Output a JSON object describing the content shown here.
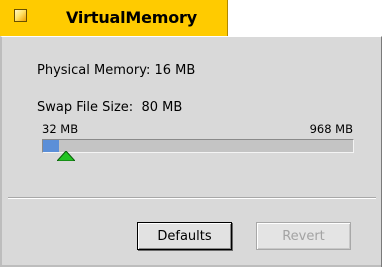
{
  "window": {
    "title": "VirtualMemory"
  },
  "physical_memory": {
    "label": "Physical Memory: 16 MB"
  },
  "swap": {
    "label": "Swap File Size:  80 MB",
    "min_label": "32 MB",
    "max_label": "968 MB",
    "min_mb": 32,
    "max_mb": 968,
    "value_mb": 80
  },
  "buttons": {
    "defaults_label": "Defaults",
    "revert_label": "Revert"
  },
  "colors": {
    "tab": "#ffcb00",
    "slider_fill": "#5b8fd8",
    "thumb": "#22c422"
  },
  "icons": {
    "close_box": "close-box-icon",
    "thumb": "slider-thumb-icon"
  }
}
